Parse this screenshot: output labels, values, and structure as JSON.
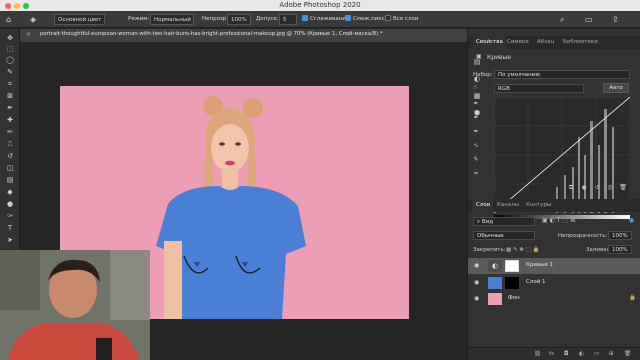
{
  "app": {
    "window_title": "Adobe Photoshop 2020"
  },
  "options_bar": {
    "preset": "Основной цвет",
    "mode_label": "Режим:",
    "mode_value": "Нормальный",
    "opacity_label": "Непрозр:",
    "opacity_value": "100%",
    "tolerance_label": "Допуск:",
    "tolerance_value": "5",
    "antialias_label": "Сглаживание",
    "contiguous_label": "Смеж.пикс",
    "all_layers_label": "Все слои"
  },
  "document_tab": {
    "title": "portrait-thoughtful-european-woman-with-two-hair-buns-has-bright-professional-makeup.jpg @ 70% (Кривые 1, Слой-маска/8) *"
  },
  "properties_panel": {
    "tabs": [
      "Свойства",
      "Символ",
      "Абзац",
      "Библиотеки"
    ],
    "adjustment_title": "Кривые",
    "preset_label": "Набор:",
    "preset_value": "По умолчанию",
    "channel_value": "RGB",
    "auto_button": "Авто"
  },
  "layers_panel": {
    "tabs": [
      "Слои",
      "Каналы",
      "Контуры"
    ],
    "filter_value": "Вид",
    "blend_mode": "Обычные",
    "opacity_label": "Непрозрачность:",
    "opacity_value": "100%",
    "lock_label": "Закрепить:",
    "fill_label": "Заливка:",
    "fill_value": "100%",
    "layers": [
      {
        "name": "Кривые 1"
      },
      {
        "name": "Слой 1"
      },
      {
        "name": "Фон"
      }
    ],
    "footer_icons": [
      "link-icon",
      "fx-icon",
      "mask-icon",
      "adjustment-icon",
      "group-icon",
      "new-layer-icon",
      "trash-icon"
    ]
  },
  "colors": {
    "background_pink": "#ec9fb4",
    "shirt_blue": "#4a7fd6",
    "accent_blue": "#4a90e2"
  }
}
